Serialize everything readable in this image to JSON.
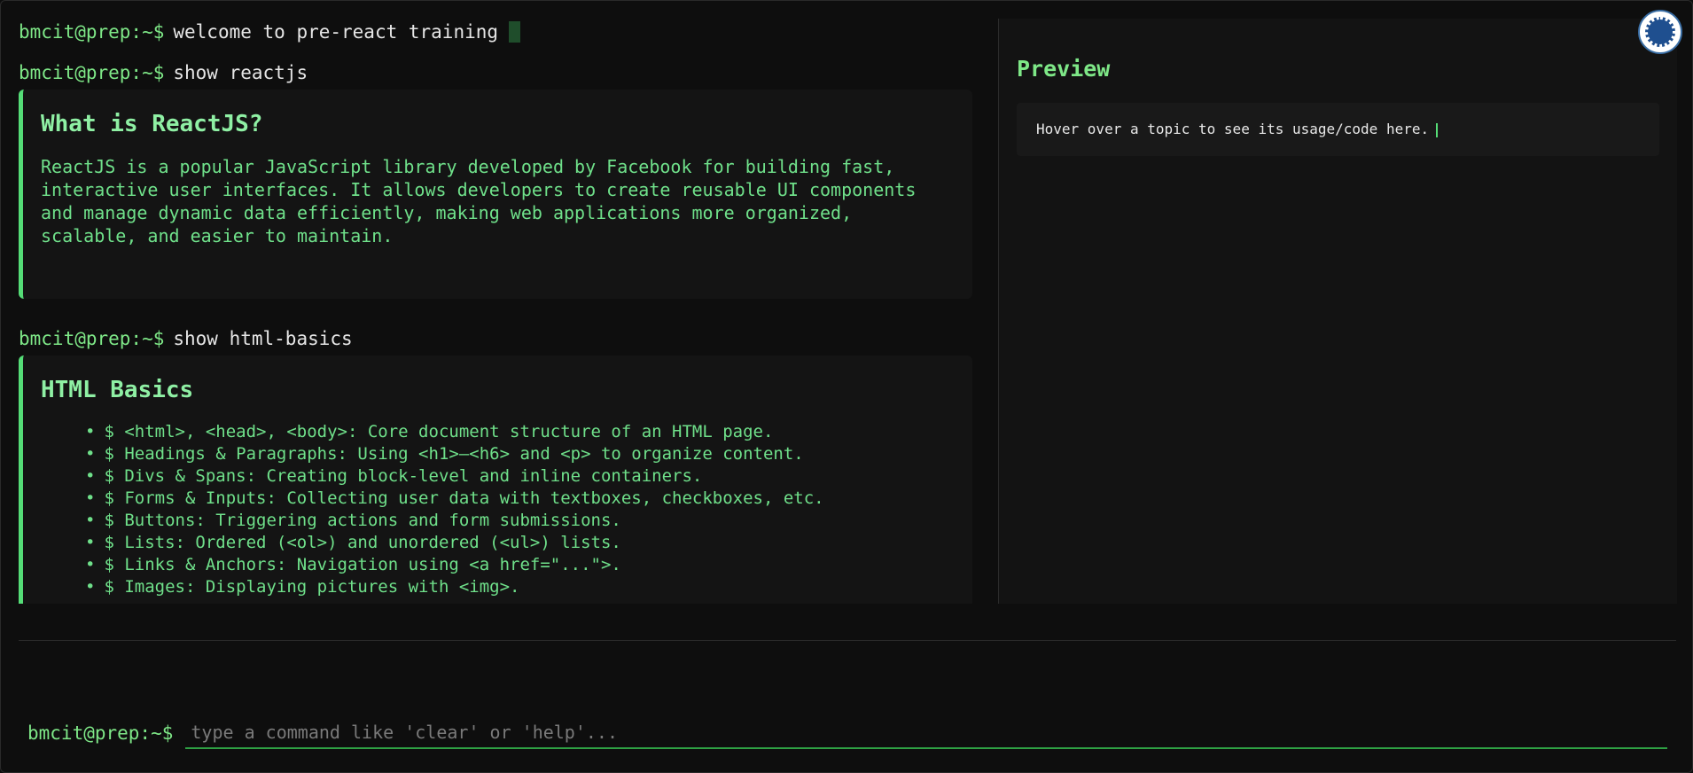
{
  "terminal": {
    "prompt": "bmcit@prep:~$",
    "welcome_cmd": "welcome to pre-react training",
    "cmd1": "show reactjs",
    "reactjs": {
      "title": "What is ReactJS?",
      "body": "ReactJS is a popular JavaScript library developed by Facebook for building fast, interactive user interfaces. It allows developers to create reusable UI components and manage dynamic data efficiently, making web applications more organized, scalable, and easier to maintain."
    },
    "cmd2": "show html-basics",
    "html_basics": {
      "title": "HTML Basics",
      "items": [
        "$ <html>, <head>, <body>: Core document structure of an HTML page.",
        "$ Headings & Paragraphs: Using <h1>–<h6> and <p> to organize content.",
        "$ Divs & Spans: Creating block-level and inline containers.",
        "$ Forms & Inputs: Collecting user data with textboxes, checkboxes, etc.",
        "$ Buttons: Triggering actions and form submissions.",
        "$ Lists: Ordered (<ol>) and unordered (<ul>) lists.",
        "$ Links & Anchors: Navigation using <a href=\"...\">.",
        "$ Images: Displaying pictures with <img>."
      ]
    }
  },
  "preview": {
    "title": "Preview",
    "hint": "Hover over a topic to see its usage/code here."
  },
  "input": {
    "prompt": "bmcit@prep:~$",
    "placeholder": "type a command like 'clear' or 'help'..."
  },
  "colors": {
    "accent": "#7ee787",
    "border_accent": "#55dd77",
    "background": "#0e0e0e"
  },
  "icons": {
    "logo": "institution-seal-icon"
  }
}
